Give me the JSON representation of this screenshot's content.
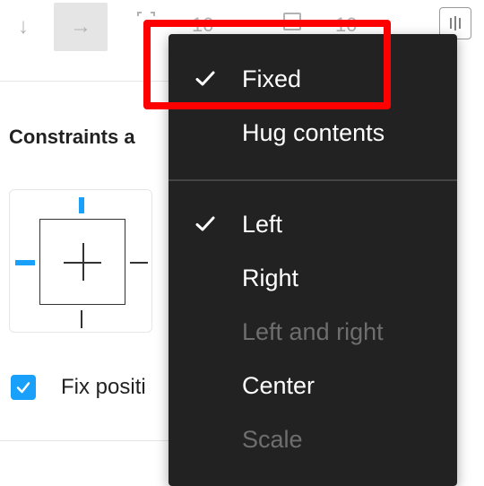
{
  "toolbar": {
    "vertical_arrow": "↓",
    "horizontal_arrow": "→",
    "radius_value": "10",
    "spacing_value": "10"
  },
  "constraints": {
    "title": "Constraints a",
    "fix_position_label": "Fix positi",
    "fix_position_checked": true,
    "accent_color": "#18a0fb"
  },
  "menu": {
    "sizing_items": [
      {
        "label": "Fixed",
        "checked": true,
        "disabled": false
      },
      {
        "label": "Hug contents",
        "checked": false,
        "disabled": false
      }
    ],
    "constraint_items": [
      {
        "label": "Left",
        "checked": true,
        "disabled": false
      },
      {
        "label": "Right",
        "checked": false,
        "disabled": false
      },
      {
        "label": "Left and right",
        "checked": false,
        "disabled": true
      },
      {
        "label": "Center",
        "checked": false,
        "disabled": false
      },
      {
        "label": "Scale",
        "checked": false,
        "disabled": true
      }
    ],
    "background": "#222222",
    "highlight_color": "#ff0000"
  }
}
